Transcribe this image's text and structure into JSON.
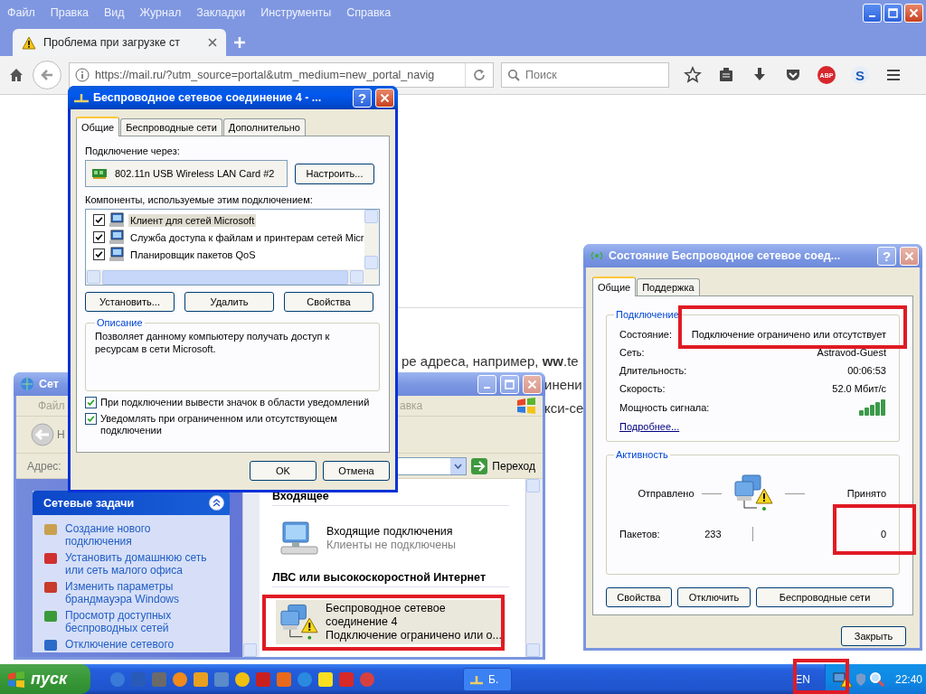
{
  "browser": {
    "menu": [
      "Файл",
      "Правка",
      "Вид",
      "Журнал",
      "Закладки",
      "Инструменты",
      "Справка"
    ],
    "tab": {
      "title": "Проблема при загрузке ст"
    },
    "url": "https://mail.ru/?utm_source=portal&utm_medium=new_portal_navig",
    "search": {
      "placeholder": "Поиск"
    },
    "adblock_label": "ABP",
    "sync_label": "S",
    "page_lines": [
      "ре адреса, например, **ww**.te",
      "инени",
      "кси-се"
    ]
  },
  "network_window": {
    "title": "Сет",
    "active": false,
    "menu": [
      "Файл",
      "авка"
    ],
    "back_label": "Н",
    "address_label": "Адрес:",
    "go_button": "Переход",
    "tasks": {
      "title": "Сетевые задачи",
      "items": [
        "Создание нового подключения",
        "Установить домашнюю сеть или сеть малого офиса",
        "Изменить параметры брандмауэра Windows",
        "Просмотр доступных беспроводных сетей",
        "Отключение сетевого"
      ]
    },
    "groups": [
      {
        "title": "Входящее",
        "items": [
          {
            "kind": "incoming",
            "name": "Входящие подключения",
            "status": "Клиенты не подключены",
            "selected": false
          }
        ]
      },
      {
        "title": "ЛВС или высокоскоростной Интернет",
        "items": [
          {
            "kind": "wireless",
            "name": "Беспроводное сетевое соединение 4",
            "status": "Подключение ограничено или о...",
            "selected": true
          }
        ]
      }
    ]
  },
  "properties_dialog": {
    "title": "Беспроводное сетевое соединение 4 - ...",
    "active": true,
    "help": "?",
    "tabs": [
      {
        "label": "Общие",
        "selected": true
      },
      {
        "label": "Беспроводные сети",
        "selected": false
      },
      {
        "label": "Дополнительно",
        "selected": false
      }
    ],
    "connect_label": "Подключение через:",
    "adapter": "802.11n USB Wireless LAN Card #2",
    "configure_button": "Настроить...",
    "components_label": "Компоненты, используемые этим подключением:",
    "components": [
      {
        "label": "Клиент для сетей Microsoft",
        "checked": true,
        "selected": true
      },
      {
        "label": "Служба доступа к файлам и принтерам сетей Micr",
        "checked": true,
        "selected": false
      },
      {
        "label": "Планировщик пакетов QoS",
        "checked": true,
        "selected": false
      }
    ],
    "component_buttons": [
      "Установить...",
      "Удалить",
      "Свойства"
    ],
    "description": {
      "title": "Описание",
      "text": "Позволяет данному компьютеру получать доступ к ресурсам в сети Microsoft."
    },
    "options": [
      {
        "label": "При подключении вывести значок в области уведомлений",
        "checked": true
      },
      {
        "label": "Уведомлять при ограниченном или отсутствующем подключении",
        "checked": true
      }
    ],
    "buttons": [
      "OK",
      "Отмена"
    ]
  },
  "status_dialog": {
    "title": "Состояние Беспроводное сетевое соед...",
    "active": false,
    "help": "?",
    "tabs": [
      {
        "label": "Общие",
        "selected": true
      },
      {
        "label": "Поддержка",
        "selected": false
      }
    ],
    "connection": {
      "title": "Подключение",
      "rows": [
        {
          "label": "Состояние:",
          "value": "Подключение ограничено или отсутствует"
        },
        {
          "label": "Сеть:",
          "value": "Astravod-Guest"
        },
        {
          "label": "Длительность:",
          "value": "00:06:53"
        },
        {
          "label": "Скорость:",
          "value": "52.0 Мбит/с"
        }
      ],
      "signal_label": "Мощность сигнала:",
      "details_link": "Подробнее..."
    },
    "activity": {
      "title": "Активность",
      "sent_label": "Отправлено",
      "received_label": "Принято",
      "packets_label": "Пакетов:",
      "packets_sent": "233",
      "packets_received": "0"
    },
    "buttons": [
      "Свойства",
      "Отключить",
      "Беспроводные сети"
    ],
    "close_button": "Закрыть"
  },
  "taskbar": {
    "start": "пуск",
    "task": "Б.",
    "language": "EN",
    "clock": "22:40"
  }
}
